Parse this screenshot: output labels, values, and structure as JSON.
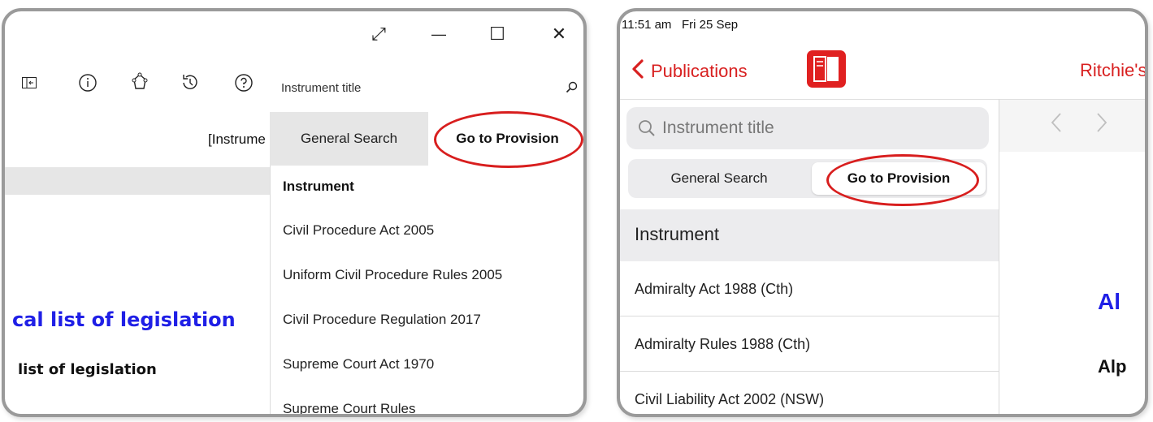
{
  "left": {
    "window_controls": {
      "expand": "⤢",
      "minimize": "—",
      "maximize": "☐",
      "close": "✕"
    },
    "toolbar_icons": [
      "panel-toggle-icon",
      "info-icon",
      "share-icon",
      "history-icon",
      "help-icon"
    ],
    "search": {
      "placeholder": "Instrument title"
    },
    "tabs": {
      "general": "General Search",
      "goto": "Go to Provision"
    },
    "list": {
      "header": "Instrument",
      "items": [
        "Civil Procedure Act 2005",
        "Uniform Civil Procedure Rules 2005",
        "Civil Procedure Regulation 2017",
        "Supreme Court Act 1970",
        "Supreme Court Rules"
      ]
    },
    "doc": {
      "bracket_text": "[Instrume",
      "blue_heading": "cal list of legislation",
      "black_heading": "list of legislation"
    }
  },
  "right": {
    "status": {
      "time": "11:51 am",
      "date": "Fri 25 Sep"
    },
    "nav": {
      "back_label": "Publications",
      "title": "Ritchie's"
    },
    "search": {
      "placeholder": "Instrument title"
    },
    "segments": {
      "general": "General Search",
      "goto": "Go to Provision"
    },
    "list": {
      "header": "Instrument",
      "items": [
        "Admiralty Act 1988 (Cth)",
        "Admiralty Rules 1988 (Cth)",
        "Civil Liability Act 2002 (NSW)"
      ]
    },
    "doc": {
      "blue_heading": "Al",
      "black_heading": "Alp"
    }
  },
  "colors": {
    "accent_red": "#d82020",
    "link_blue": "#1f1fe6",
    "panel_border": "#9a9a9a"
  }
}
